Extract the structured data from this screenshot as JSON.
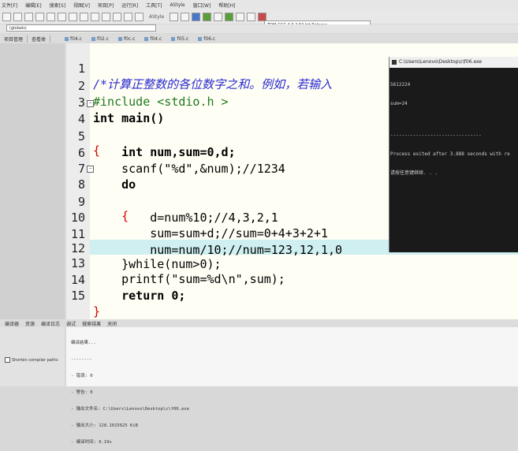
{
  "menu": [
    "文件[F]",
    "编辑[E]",
    "搜索[S]",
    "视图[V]",
    "项目[P]",
    "运行[R]",
    "工具[T]",
    "AStyle",
    "窗口[W]",
    "帮助[H]"
  ],
  "toolbar": {
    "astyle_label": "AStyle"
  },
  "compiler": {
    "selected": "TDM-GCC 4.9.2 64-bit Release"
  },
  "globals": {
    "label": "(globals)"
  },
  "panel_tabs": [
    "项目管理",
    "查看类"
  ],
  "file_tabs": [
    "f04.c",
    "f02.c",
    "f0c.c",
    "f04.c",
    "f05.c",
    "f06.c"
  ],
  "code": [
    {
      "n": "1",
      "text": "/*计算正整数的各位数字之和。例如，若输入"
    },
    {
      "n": "2",
      "text": "#include <stdio.h >"
    },
    {
      "n": "3",
      "text": "int main()"
    },
    {
      "n": "4",
      "text": "{"
    },
    {
      "n": "5",
      "text": "    int num,sum=0,d;"
    },
    {
      "n": "6",
      "text": "    scanf(\"%d\",&num);//1234"
    },
    {
      "n": "7",
      "text": "    do"
    },
    {
      "n": "8",
      "text": "    {"
    },
    {
      "n": "9",
      "text": "        d=num%10;//4,3,2,1"
    },
    {
      "n": "10",
      "text": "        sum=sum+d;//sum=0+4+3+2+1"
    },
    {
      "n": "11",
      "text": "        num=num/10;//num=123,12,1,0"
    },
    {
      "n": "12",
      "text": "    }while(num>0);"
    },
    {
      "n": "13",
      "text": "    printf(\"sum=%d\\n\",sum);"
    },
    {
      "n": "14",
      "text": "    return 0;"
    },
    {
      "n": "15",
      "text": "}"
    }
  ],
  "console": {
    "title": "C:\\Users\\Lenovo\\Desktop\\c\\f06.exe",
    "lines": [
      "5612224",
      "sum=24",
      "",
      "--------------------------------",
      "Process exited after 3.888 seconds with re",
      "请按任意键继续. . ."
    ]
  },
  "bottom_tabs": [
    "编译器",
    "资源",
    "编译日志",
    "调试",
    "搜索结果",
    "关闭"
  ],
  "shorten_label": "Shorten compiler paths",
  "output_lines": [
    "编译结果...",
    "--------",
    "- 错误: 0",
    "- 警告: 0",
    "- 输出文件名: C:\\Users\\Lenovo\\Desktop\\c\\f06.exe",
    "- 输出大小: 128.1015625 KiB",
    "- 编译时间: 0.19s"
  ]
}
